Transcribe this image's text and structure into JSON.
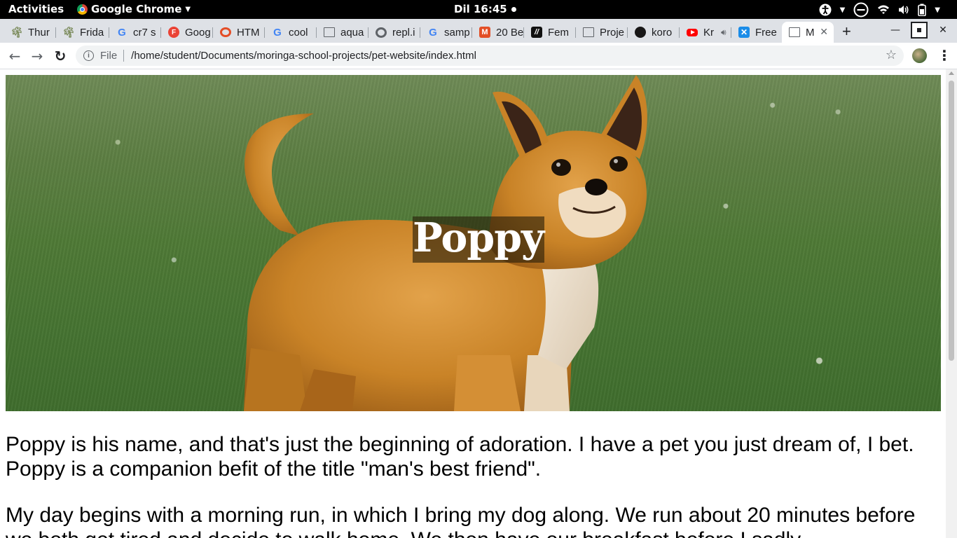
{
  "topbar": {
    "activities": "Activities",
    "app_name": "Google Chrome",
    "clock": "Dil 16:45"
  },
  "tabs": [
    {
      "label": "Thur",
      "icon": "tree-icon"
    },
    {
      "label": "Frida",
      "icon": "tree-icon"
    },
    {
      "label": "cr7 s",
      "icon": "google-icon"
    },
    {
      "label": "Goog",
      "icon": "f-icon"
    },
    {
      "label": "HTM",
      "icon": "html-icon"
    },
    {
      "label": "cool",
      "icon": "google-icon"
    },
    {
      "label": "aqua",
      "icon": "document-icon"
    },
    {
      "label": "repl.i",
      "icon": "replit-icon"
    },
    {
      "label": "samp",
      "icon": "google-icon"
    },
    {
      "label": "20 Be",
      "icon": "m-icon"
    },
    {
      "label": "Fem",
      "icon": "fm-icon"
    },
    {
      "label": "Proje",
      "icon": "document-icon"
    },
    {
      "label": "koro",
      "icon": "github-icon"
    },
    {
      "label": "Kr",
      "icon": "youtube-icon"
    },
    {
      "label": "Free",
      "icon": "freecodecamp-icon"
    },
    {
      "label": "M",
      "icon": "document-icon"
    }
  ],
  "toolbar": {
    "scheme_label": "File",
    "url": "/home/student/Documents/moringa-school-projects/pet-website/index.html"
  },
  "page": {
    "hero_title": "Poppy",
    "paragraph_1": "Poppy is his name, and that's just the beginning of adoration. I have a pet you just dream of, I bet. Poppy is a companion befit of the title \"man's best friend\".",
    "paragraph_2": "My day begins with a morning run, in which I bring my dog along. We run about 20 minutes before we both get tired and decide to walk home. We then have our breakfast before I sadly"
  },
  "colors": {
    "topbar_bg": "#000000",
    "tabstrip_bg": "#dee1e6",
    "omnibox_bg": "#f1f3f4"
  }
}
